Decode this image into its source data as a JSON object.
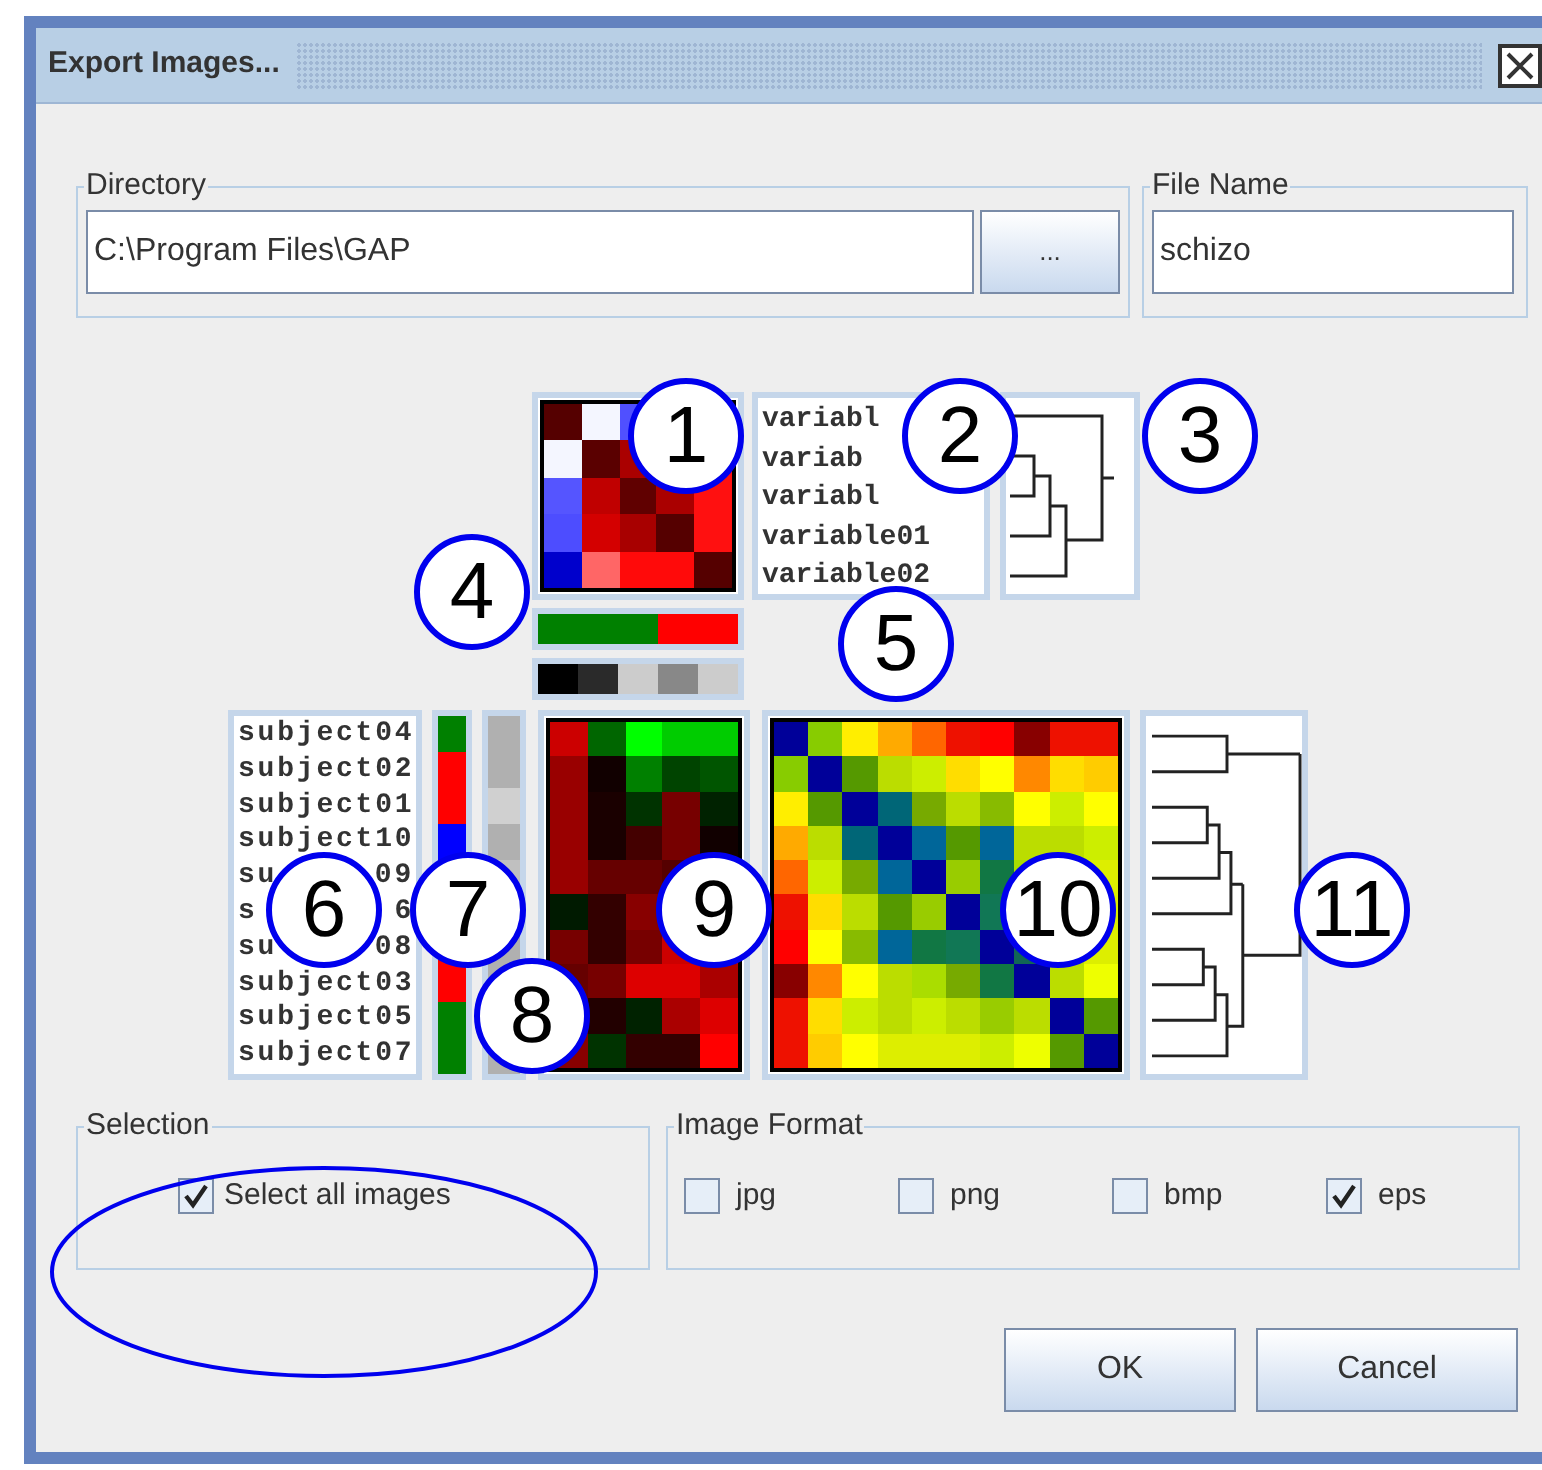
{
  "window": {
    "title": "Export Images..."
  },
  "directory": {
    "label": "Directory",
    "value": "C:\\Program Files\\GAP",
    "browse_button": "..."
  },
  "file_name": {
    "label": "File Name",
    "value": "schizo"
  },
  "variable_labels": [
    "variabl",
    "variab",
    "variabl",
    "variable01",
    "variable02"
  ],
  "subject_labels": [
    [
      "subject04"
    ],
    [
      "subject02"
    ],
    [
      "subject01"
    ],
    [
      "subject10"
    ],
    [
      "su",
      "09"
    ],
    [
      "s",
      "6"
    ],
    [
      "su",
      "08"
    ],
    [
      "subject03"
    ],
    [
      "subject05"
    ],
    [
      "subject07"
    ]
  ],
  "callouts": [
    "1",
    "2",
    "3",
    "4",
    "5",
    "6",
    "7",
    "8",
    "9",
    "10",
    "11"
  ],
  "selection": {
    "label": "Selection",
    "checkbox": {
      "label": "Select all images",
      "checked": true
    }
  },
  "image_format": {
    "label": "Image Format",
    "options": [
      {
        "label": "jpg",
        "checked": false
      },
      {
        "label": "png",
        "checked": false
      },
      {
        "label": "bmp",
        "checked": false
      },
      {
        "label": "eps",
        "checked": true
      }
    ]
  },
  "buttons": [
    "OK",
    "Cancel"
  ]
}
